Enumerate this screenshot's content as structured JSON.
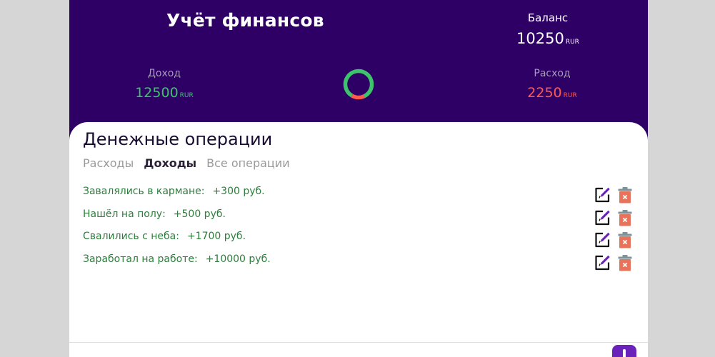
{
  "app": {
    "title": "Учёт финансов"
  },
  "balance": {
    "label": "Баланс",
    "value": "10250",
    "currency": "RUR"
  },
  "income": {
    "label": "Доход",
    "value": "12500",
    "currency": "RUR",
    "color": "#3dc46a"
  },
  "expense": {
    "label": "Расход",
    "value": "2250",
    "currency": "RUR",
    "color": "#ff5a4e"
  },
  "donut": {
    "income_share": 0.847,
    "expense_share": 0.153
  },
  "operations": {
    "title": "Денежные операции",
    "tabs": [
      {
        "label": "Расходы",
        "active": false
      },
      {
        "label": "Доходы",
        "active": true
      },
      {
        "label": "Все операции",
        "active": false
      }
    ],
    "items": [
      {
        "text": "Завалялись в кармане:",
        "amount": "+300 руб."
      },
      {
        "text": "Нашёл на полу:",
        "amount": "+500 руб."
      },
      {
        "text": "Свалились с неба:",
        "amount": "+1700 руб."
      },
      {
        "text": "Заработал на работе:",
        "amount": "+10000 руб."
      }
    ]
  },
  "footer": {
    "left_label": "",
    "right_label": ""
  },
  "colors": {
    "header_bg": "#2e0066",
    "income": "#3dc46a",
    "expense": "#ff5a4e",
    "operation_text": "#2d7d3c",
    "delete_icon": "#e8735a",
    "accent": "#6a22bb"
  }
}
